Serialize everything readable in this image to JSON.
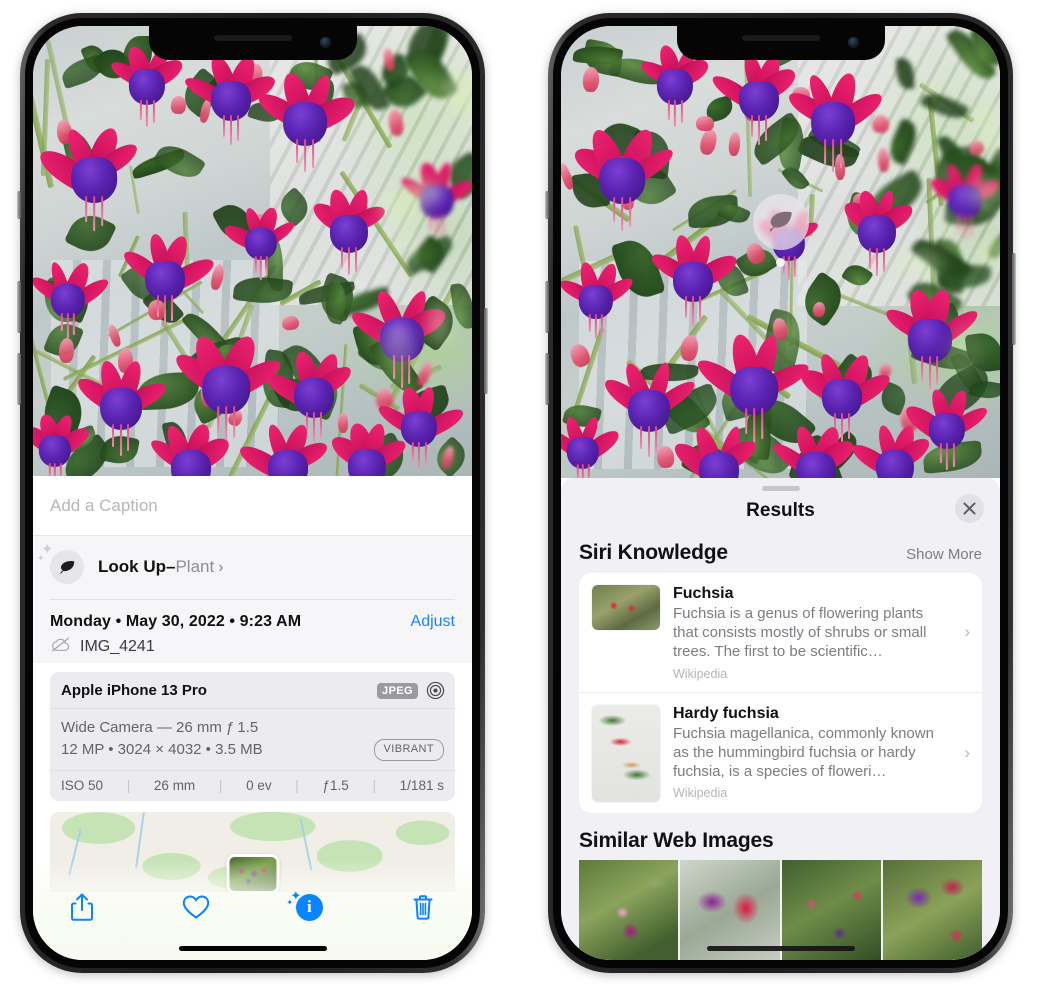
{
  "left_phone": {
    "caption_placeholder": "Add a Caption",
    "lookup": {
      "title": "Look Up",
      "dash": "–",
      "subject": "Plant",
      "chevron": "›",
      "icon": "leaf-icon"
    },
    "meta": {
      "date": "Monday • May 30, 2022 • 9:23 AM",
      "adjust_label": "Adjust",
      "filename": "IMG_4241",
      "cloud_icon": "icloud-slash-icon"
    },
    "exif": {
      "device": "Apple iPhone 13 Pro",
      "format_tag": "JPEG",
      "aperture_icon": "aperture-icon",
      "lens_line": "Wide Camera — 26 mm ƒ 1.5",
      "size_line": "12 MP • 3024 × 4032 • 3.5 MB",
      "style_tag": "VIBRANT",
      "stats": [
        "ISO 50",
        "26 mm",
        "0 ev",
        "ƒ1.5",
        "1/181 s"
      ]
    },
    "toolbar": [
      {
        "name": "share-button",
        "icon": "share-icon"
      },
      {
        "name": "favorite-button",
        "icon": "heart-icon"
      },
      {
        "name": "info-button",
        "icon": "info-sparkle-icon",
        "glyph": "i"
      },
      {
        "name": "delete-button",
        "icon": "trash-icon"
      }
    ]
  },
  "right_phone": {
    "visual_lookup_badge": {
      "icon": "leaf-icon"
    },
    "sheet": {
      "title": "Results",
      "close_icon": "close-icon",
      "sections": [
        {
          "title": "Siri Knowledge",
          "action": "Show More",
          "items": [
            {
              "title": "Fuchsia",
              "description": "Fuchsia is a genus of flowering plants that consists mostly of shrubs or small trees. The first to be scientific…",
              "source": "Wikipedia",
              "chevron": "›"
            },
            {
              "title": "Hardy fuchsia",
              "description": "Fuchsia magellanica, commonly known as the hummingbird fuchsia or hardy fuchsia, is a species of floweri…",
              "source": "Wikipedia",
              "chevron": "›"
            }
          ]
        },
        {
          "title": "Similar Web Images",
          "images": [
            "fuchsia-web-image-1",
            "fuchsia-web-image-2",
            "fuchsia-web-image-3",
            "fuchsia-web-image-4"
          ]
        }
      ]
    }
  },
  "colors": {
    "accent_blue": "#0a84ff",
    "sheet_bg": "#f1f0f5",
    "card_bg": "#ffffff",
    "secondary_text": "#7c7c83",
    "tertiary_text": "#b4b4ba"
  }
}
